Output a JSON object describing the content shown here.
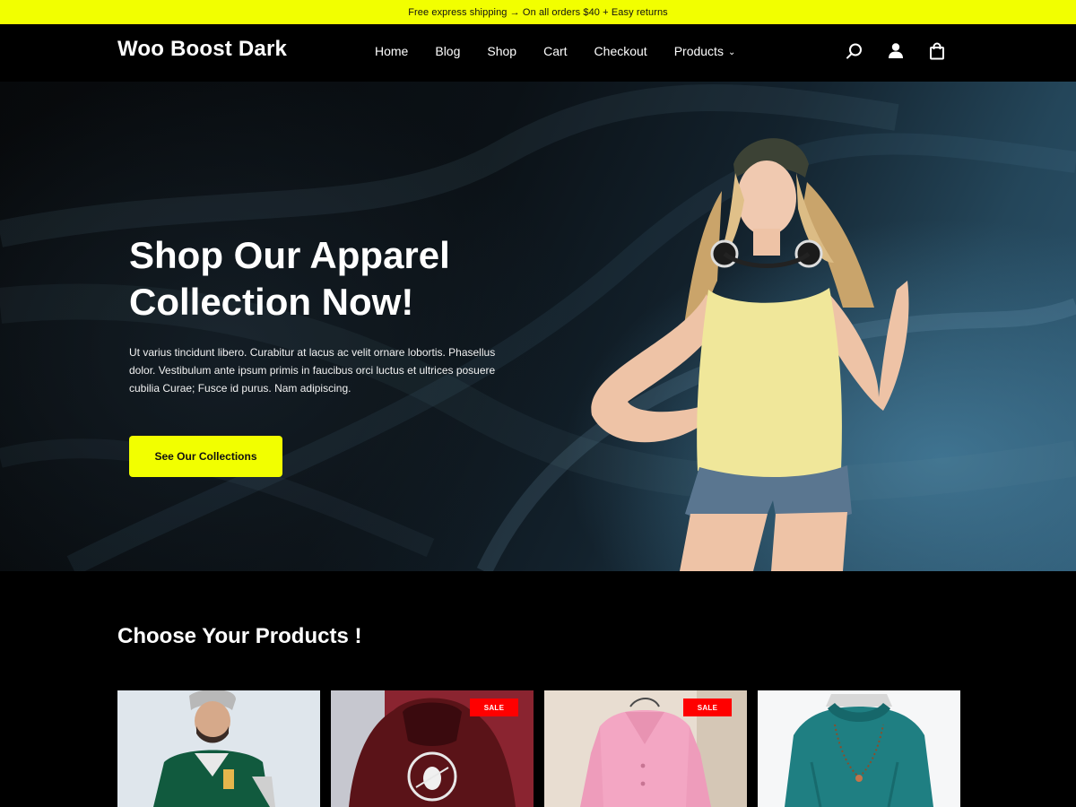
{
  "announcement": "Free express shipping → On all orders $40 + Easy returns",
  "header": {
    "logo": "Woo Boost Dark",
    "nav": [
      {
        "label": "Home"
      },
      {
        "label": "Blog"
      },
      {
        "label": "Shop"
      },
      {
        "label": "Cart"
      },
      {
        "label": "Checkout"
      },
      {
        "label": "Products",
        "has_dropdown": true
      }
    ],
    "icons": [
      "search-icon",
      "user-icon",
      "shopping-bag-icon"
    ]
  },
  "hero": {
    "title_line1": "Shop Our Apparel",
    "title_line2": "Collection Now!",
    "description": "Ut varius tincidunt libero. Curabitur at lacus ac velit ornare lobortis. Phasellus dolor. Vestibulum ante ipsum primis in faucibus orci luctus et ultrices posuere cubilia Curae; Fusce id purus. Nam adipiscing.",
    "button_label": "See Our Collections"
  },
  "products_section": {
    "title": "Choose Your Products !",
    "products": [
      {
        "image": "man-green-hoodie",
        "sale": false
      },
      {
        "image": "maroon-sons-of-anarchy-hoodie",
        "sale": true,
        "badge": "SALE"
      },
      {
        "image": "pink-coat",
        "sale": true,
        "badge": "SALE"
      },
      {
        "image": "teal-knit-sweater",
        "sale": false
      }
    ]
  },
  "colors": {
    "accent": "#f2ff00",
    "background": "#000000",
    "sale": "#ff0000"
  }
}
